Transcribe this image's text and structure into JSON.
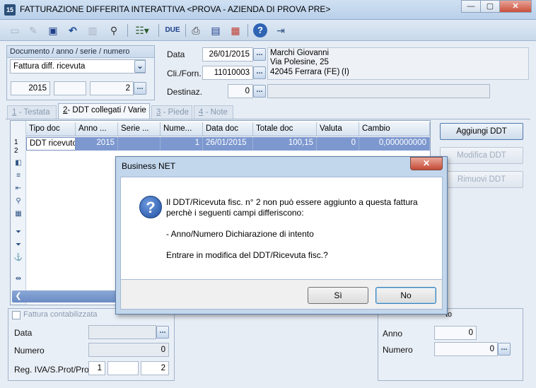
{
  "window": {
    "app_icon": "15",
    "title": "FATTURAZIONE DIFFERITA INTERATTIVA <PROVA - AZIENDA DI PROVA PRE>",
    "controls": [
      "—",
      "▢",
      "✕"
    ]
  },
  "toolbar": {
    "icons": [
      "new-doc-icon",
      "open-icon",
      "save-icon",
      "undo-icon",
      "delete-icon",
      "find-icon",
      "list-options-icon",
      "due-icon",
      "print-icon",
      "preview-icon",
      "pdf-icon",
      "help-icon",
      "exit-icon"
    ],
    "due_label": "DUE"
  },
  "documento": {
    "group_title": "Documento / anno / serie / numero",
    "tipo": "Fattura diff. ricevuta",
    "anno": "2015",
    "serie": "",
    "numero": "2",
    "dots": "..."
  },
  "header": {
    "data_label": "Data",
    "data_value": "26/01/2015",
    "cli_label": "Cli./Forn.",
    "cli_value": "11010003",
    "destinaz_label": "Destinaz.",
    "destinaz_value": "0",
    "address": {
      "name": "Marchi Giovanni",
      "street": "Via Polesine, 25",
      "city": "42045 Ferrara (FE)",
      "country": "(I)"
    }
  },
  "tabs": [
    {
      "num": "1",
      "label": " - Testata"
    },
    {
      "num": "2",
      "label": "- DDT collegati / Varie"
    },
    {
      "num": "3",
      "label": " - Piede"
    },
    {
      "num": "4",
      "label": " - Note"
    }
  ],
  "grid": {
    "columns": [
      "Tipo doc",
      "Anno ...",
      "Serie ...",
      "Nume...",
      "Data doc",
      "Totale doc",
      "Valuta",
      "Cambio"
    ],
    "row_numbers": [
      "1",
      "2"
    ],
    "rows": [
      [
        "DDT ricevuto",
        "2015",
        "",
        "1",
        "26/01/2015",
        "100,15",
        "0",
        "0,000000000"
      ]
    ]
  },
  "side_buttons": {
    "add": "Aggiungi DDT",
    "edit": "Modifica DDT",
    "remove": "Rimuovi DDT"
  },
  "bottom_left": {
    "check_label": "Fattura contabilizzata",
    "data_label": "Data",
    "numero_label": "Numero",
    "numero_value": "0",
    "reg_label": "Reg. IVA/S.Prot/Prot",
    "reg_iva": "1",
    "reg_sprot": "",
    "reg_prot": "2"
  },
  "bottom_right": {
    "title_fragment": "to",
    "anno_label": "Anno",
    "anno_value": "0",
    "numero_label": "Numero",
    "numero_value": "0"
  },
  "dialog": {
    "title": "Business NET",
    "close": "✕",
    "icon": "?",
    "line1": "Il DDT/Ricevuta fisc. n° 2 non può essere aggiunto a questa fattura",
    "line2": "perchè i seguenti campi differiscono:",
    "line3": "- Anno/Numero Dichiarazione di intento",
    "line4": "Entrare in modifica del DDT/Ricevuta fisc.?",
    "yes": "Sì",
    "no": "No"
  }
}
